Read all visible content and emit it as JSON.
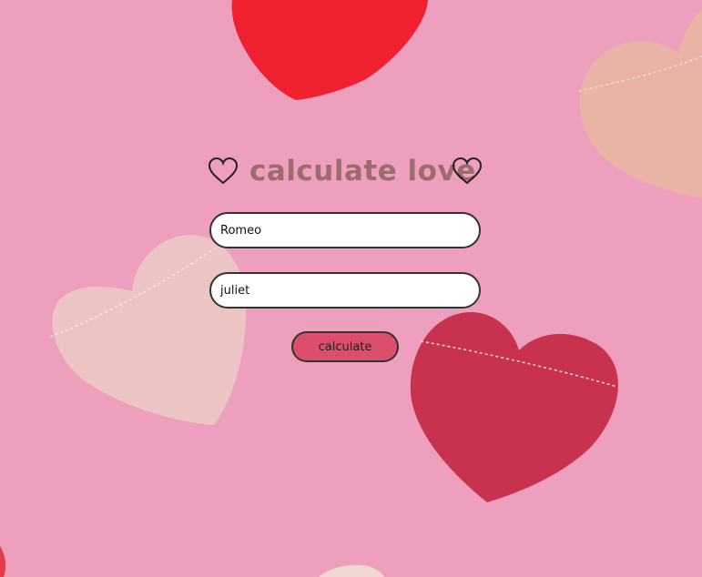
{
  "title": "calculate love",
  "icons": {
    "left": "heart-outline-icon",
    "right": "heart-outline-icon"
  },
  "form": {
    "name1_value": "Romeo",
    "name2_value": "juliet",
    "button_label": "calculate"
  },
  "colors": {
    "background": "#ee9fbd",
    "title": "#9b6c6c",
    "button": "#db4f6c",
    "border": "#333333"
  }
}
